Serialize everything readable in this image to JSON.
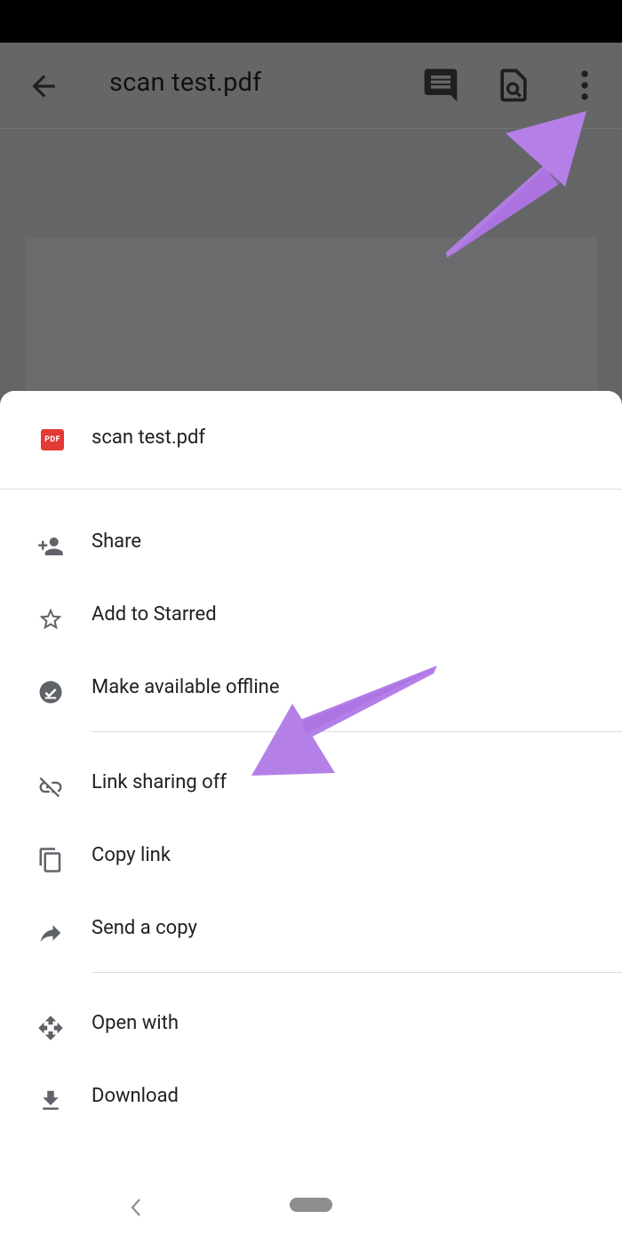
{
  "appbar": {
    "title": "scan test.pdf",
    "icons": [
      "back-arrow-icon",
      "comment-icon",
      "find-in-page-icon",
      "more-vert-icon"
    ]
  },
  "sheet": {
    "file_title": "scan test.pdf",
    "file_badge": "PDF",
    "groups": [
      [
        {
          "label": "Share",
          "icon": "person-add-icon"
        },
        {
          "label": "Add to Starred",
          "icon": "star-outline-icon"
        },
        {
          "label": "Make available offline",
          "icon": "offline-check-icon"
        }
      ],
      [
        {
          "label": "Link sharing off",
          "icon": "link-off-icon"
        },
        {
          "label": "Copy link",
          "icon": "copy-icon"
        },
        {
          "label": "Send a copy",
          "icon": "share-arrow-icon"
        }
      ],
      [
        {
          "label": "Open with",
          "icon": "open-with-icon"
        },
        {
          "label": "Download",
          "icon": "download-icon"
        }
      ]
    ]
  },
  "colors": {
    "annotation_arrow": "#b57fe8",
    "pdf_badge": "#e53935",
    "scrim": "#5f6368"
  }
}
